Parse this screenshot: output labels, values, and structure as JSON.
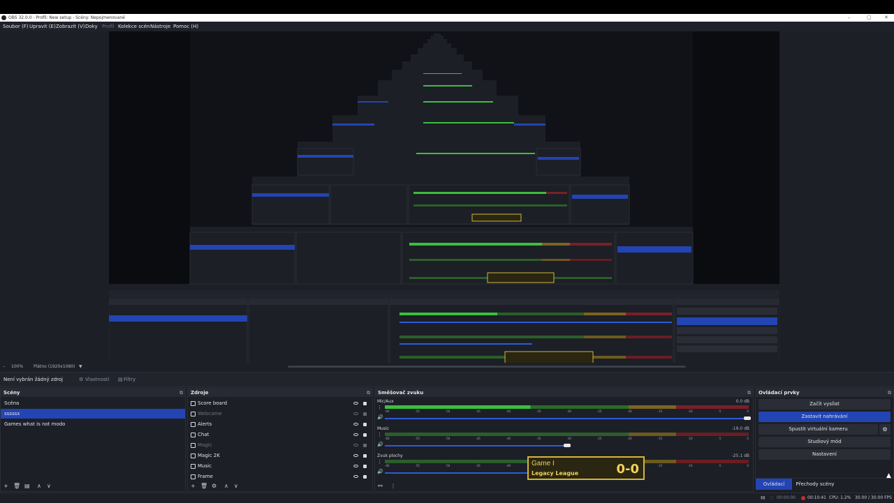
{
  "window": {
    "title": "OBS 32.0.0 - Profil: New setup - Scény: Nepojmenované",
    "controls": [
      "–",
      "▢",
      "✕"
    ]
  },
  "menu": [
    {
      "label": "Soubor (F)",
      "enabled": true
    },
    {
      "label": "Upravit (E)",
      "enabled": true
    },
    {
      "label": "Zobrazit (V)",
      "enabled": true
    },
    {
      "label": "Doky",
      "enabled": true
    },
    {
      "label": "Profil",
      "enabled": false
    },
    {
      "label": "Kolekce scén",
      "enabled": true
    },
    {
      "label": "Nástroje",
      "enabled": true
    },
    {
      "label": "Pomoc (H)",
      "enabled": true
    }
  ],
  "zoom": {
    "percent": "100%",
    "canvas": "Plátno (1920x1080)"
  },
  "propbar": {
    "status": "Není vybrán žádný zdroj",
    "properties": "Vlastnosti",
    "filters": "Filtry"
  },
  "scenes": {
    "title": "Scény",
    "items": [
      {
        "label": "Scéna",
        "selected": false
      },
      {
        "label": "sssssx",
        "selected": true
      },
      {
        "label": "Games what is not modo",
        "selected": false
      }
    ]
  },
  "sources": {
    "title": "Zdroje",
    "items": [
      {
        "label": "Score board",
        "icon": "image-source-icon",
        "visible": true
      },
      {
        "label": "Webcame",
        "icon": "camera-source-icon",
        "visible": false
      },
      {
        "label": "Alerts",
        "icon": "browser-source-icon",
        "visible": true
      },
      {
        "label": "Chat",
        "icon": "browser-source-icon",
        "visible": true
      },
      {
        "label": "Magic",
        "icon": "image-source-icon",
        "visible": false
      },
      {
        "label": "Magic 2K",
        "icon": "media-source-icon",
        "visible": true
      },
      {
        "label": "Music",
        "icon": "audio-source-icon",
        "visible": true
      },
      {
        "label": "Frame",
        "icon": "media-source-icon",
        "visible": true
      }
    ]
  },
  "mixer": {
    "title": "Směšovač zvuku",
    "ticks": [
      "-60",
      "-55",
      "-50",
      "-45",
      "-40",
      "-35",
      "-30",
      "-25",
      "-20",
      "-15",
      "-10",
      "-5",
      "0"
    ],
    "channels": [
      {
        "name": "Mic/Aux",
        "db": "0.0 dB",
        "active": true,
        "fader": 0.99
      },
      {
        "name": "Music",
        "db": "-19.0 dB",
        "active": false,
        "fader": 0.5
      },
      {
        "name": "Zvuk plochy",
        "db": "-25.1 dB",
        "active": false,
        "fader": 0.4
      }
    ]
  },
  "controls": {
    "title": "Ovládací prvky",
    "buttons": [
      {
        "label": "Začít vysílat",
        "active": false
      },
      {
        "label": "Zastavit nahrávání",
        "active": true
      },
      {
        "label": "Spustit virtuální kameru",
        "active": false
      },
      {
        "label": "Studiový mód",
        "active": false
      },
      {
        "label": "Nastavení",
        "active": false
      }
    ]
  },
  "bottom_tabs": [
    "Ovládací prvky",
    "Přechody scény"
  ],
  "scoreboard": {
    "title": "Game I",
    "subtitle": "Legacy League",
    "score": "0-0"
  },
  "status": {
    "stream_time": "00:00:00",
    "rec_time": "00:10:41",
    "cpu": "CPU: 1.2%",
    "fps": "30.00 / 30.00 FPS"
  },
  "colors": {
    "accent": "#2344b3",
    "meter_green": "#3cbf3c",
    "meter_yellow": "#7c6422",
    "meter_red": "#7a2027",
    "scoreboard_border": "#d4b63a"
  }
}
